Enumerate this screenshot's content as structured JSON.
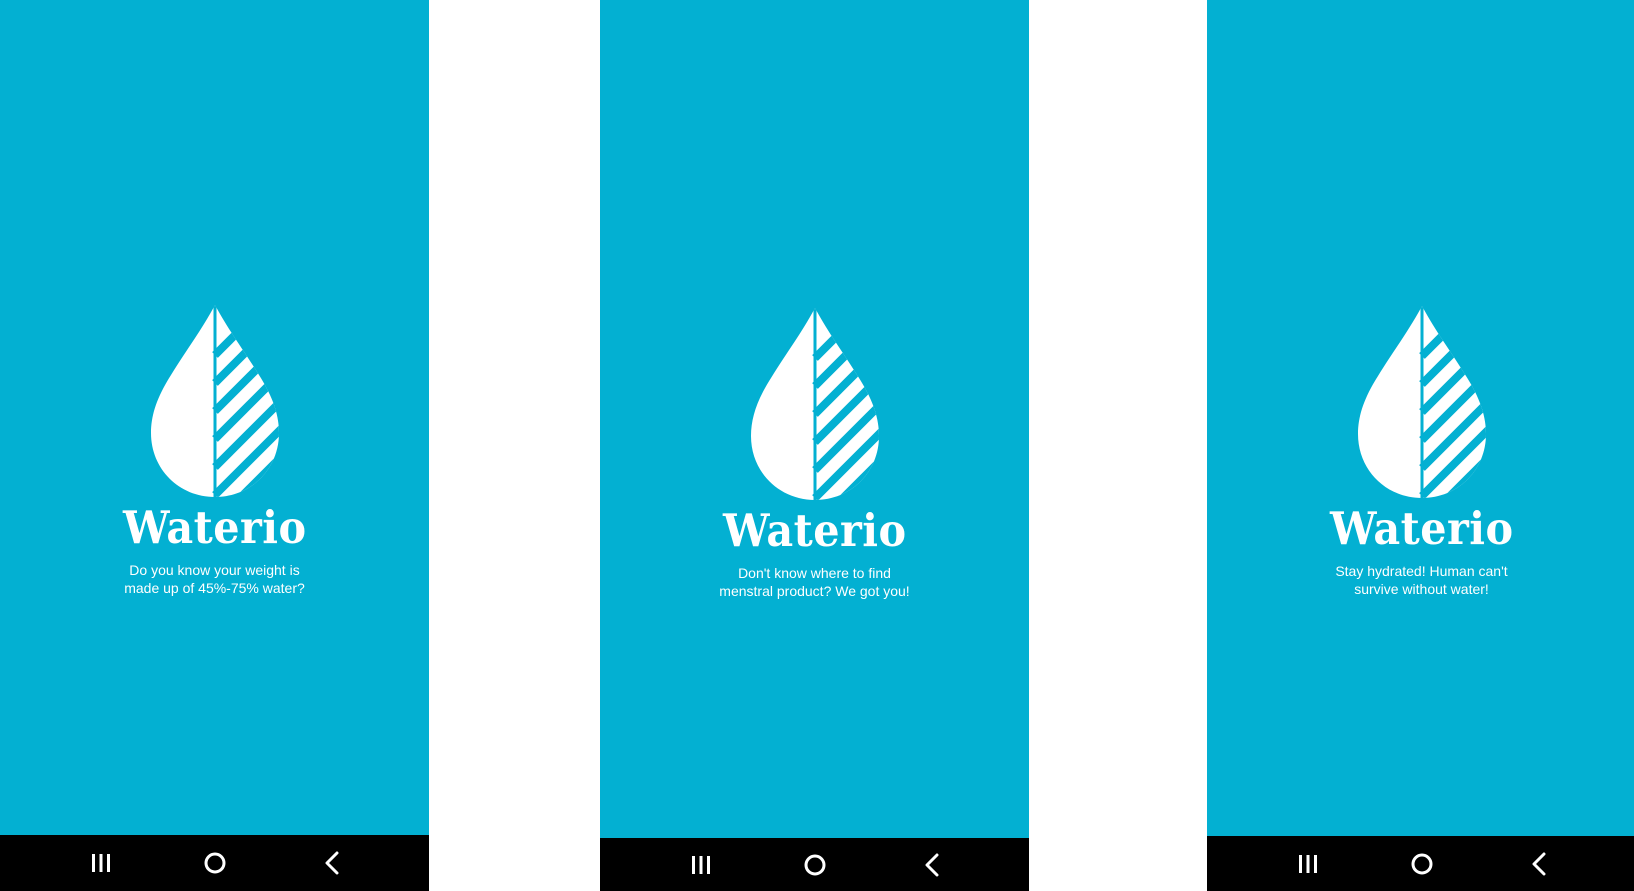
{
  "theme": {
    "primary": "#03b0d2",
    "nav_bar": "#000000",
    "text": "#ffffff",
    "page_background": "#ffffff"
  },
  "screens": [
    {
      "brand_name": "Waterio",
      "tagline_line1": "Do you know your weight is",
      "tagline_line2": "made up of 45%-75% water?",
      "logo_icon": "water-drop-icon",
      "nav": {
        "recents_icon": "recent-apps-icon",
        "home_icon": "home-icon",
        "back_icon": "back-icon"
      }
    },
    {
      "brand_name": "Waterio",
      "tagline_line1": "Don't know where to find",
      "tagline_line2": "menstral product? We got you!",
      "logo_icon": "water-drop-icon",
      "nav": {
        "recents_icon": "recent-apps-icon",
        "home_icon": "home-icon",
        "back_icon": "back-icon"
      }
    },
    {
      "brand_name": "Waterio",
      "tagline_line1": "Stay hydrated! Human can't",
      "tagline_line2": "survive without water!",
      "logo_icon": "water-drop-icon",
      "nav": {
        "recents_icon": "recent-apps-icon",
        "home_icon": "home-icon",
        "back_icon": "back-icon"
      }
    }
  ]
}
